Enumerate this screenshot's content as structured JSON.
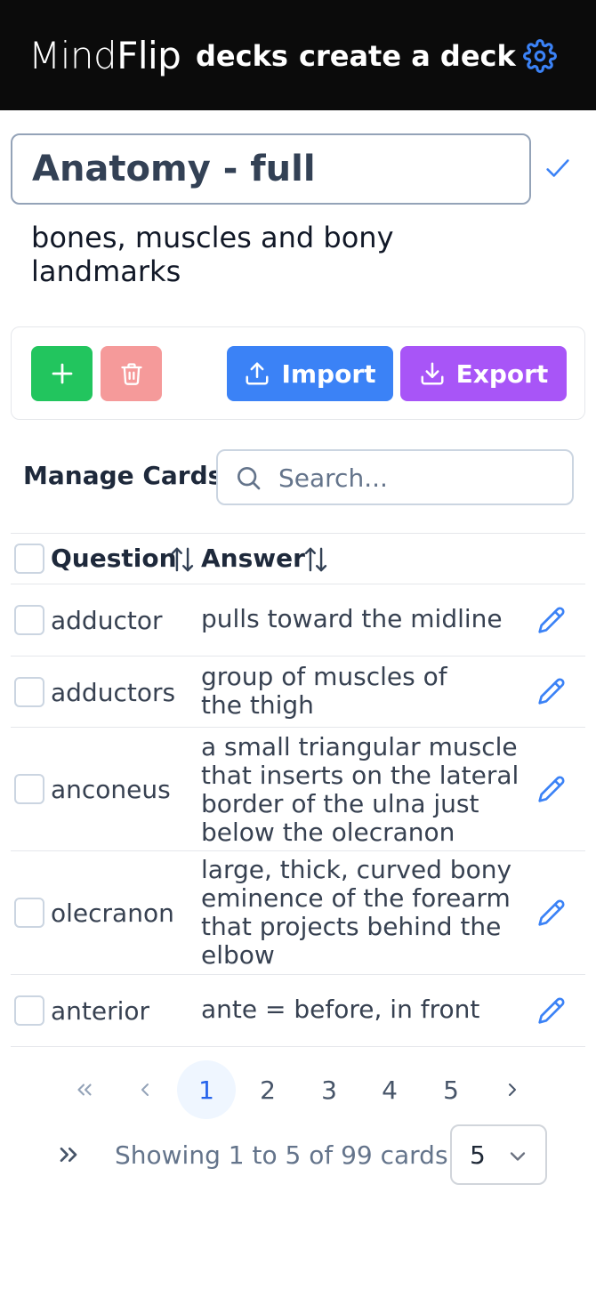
{
  "nav": {
    "brand_part1": "Mind",
    "brand_part2": "Flip",
    "decks": "decks",
    "create_deck": "create a deck"
  },
  "deck": {
    "title": "Anatomy - full",
    "description": "bones, muscles and bony landmarks"
  },
  "toolbar": {
    "import_label": "Import",
    "export_label": "Export"
  },
  "manage": {
    "title": "Manage Cards",
    "search_placeholder": "Search..."
  },
  "table": {
    "headers": {
      "question": "Question",
      "answer": "Answer"
    },
    "rows": [
      {
        "question": "adductor",
        "answer": "pulls toward the midline"
      },
      {
        "question": "adductors",
        "answer": "group of muscles of the thigh"
      },
      {
        "question": "anconeus",
        "answer": "a small triangular muscle that inserts on the lateral border of the ulna just below the olecranon"
      },
      {
        "question": "olecranon",
        "answer": "large, thick, curved bony eminence of the forearm that projects behind the elbow"
      },
      {
        "question": "anterior",
        "answer": "ante = before, in front"
      }
    ]
  },
  "pagination": {
    "pages": [
      "1",
      "2",
      "3",
      "4",
      "5"
    ],
    "current": "1",
    "showing": "Showing 1 to 5 of 99 cards",
    "per_page": "5"
  },
  "colors": {
    "accent": "#3b82f6",
    "add": "#22c55e",
    "delete": "#f59a9a",
    "export": "#a855f7"
  },
  "icons": [
    "gear-icon",
    "check-icon",
    "plus-icon",
    "trash-icon",
    "upload-icon",
    "download-icon",
    "search-icon",
    "sort-icon",
    "edit-pencil-icon",
    "chevrons-left-icon",
    "chevron-left-icon",
    "chevron-right-icon",
    "chevrons-right-icon",
    "chevron-down-icon"
  ]
}
